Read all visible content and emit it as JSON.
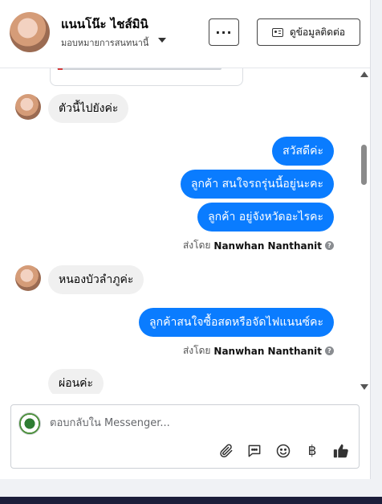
{
  "header": {
    "contact_name": "แนนโน๊ะ ไชส์มินิ",
    "subtitle": "มอบหมายการสนทนานี้",
    "more_label": "···",
    "contact_button_label": "ดูข้อมูลติดต่อ"
  },
  "thread": {
    "messages": [
      {
        "direction": "incoming",
        "text": "ตัวนี้ไปยังค่ะ"
      },
      {
        "direction": "outgoing",
        "text": "สวัสดีค่ะ"
      },
      {
        "direction": "outgoing",
        "text": "ลูกค้า สนใจรถรุ่นนี้อยู่นะคะ"
      },
      {
        "direction": "outgoing",
        "text": "ลูกค้า   อยู่จังหวัดอะไรคะ"
      },
      {
        "direction": "incoming",
        "text": "หนองบัวลำภูค่ะ"
      },
      {
        "direction": "outgoing",
        "text": "ลูกค้าสนใจซื้อสดหรือจัดไฟแนนซ์คะ"
      },
      {
        "direction": "incoming",
        "text": "ผ่อนค่ะ"
      }
    ],
    "sent_by_prefix": "ส่งโดย",
    "sent_by_name": "Nanwhan Nanthanit",
    "help_mark": "?"
  },
  "composer": {
    "placeholder": "ตอบกลับใน Messenger...",
    "currency_symbol": "฿"
  },
  "colors": {
    "outgoing_bubble": "#0a7cff",
    "incoming_bubble": "#f0f0f0",
    "like_icon": "#333333"
  }
}
